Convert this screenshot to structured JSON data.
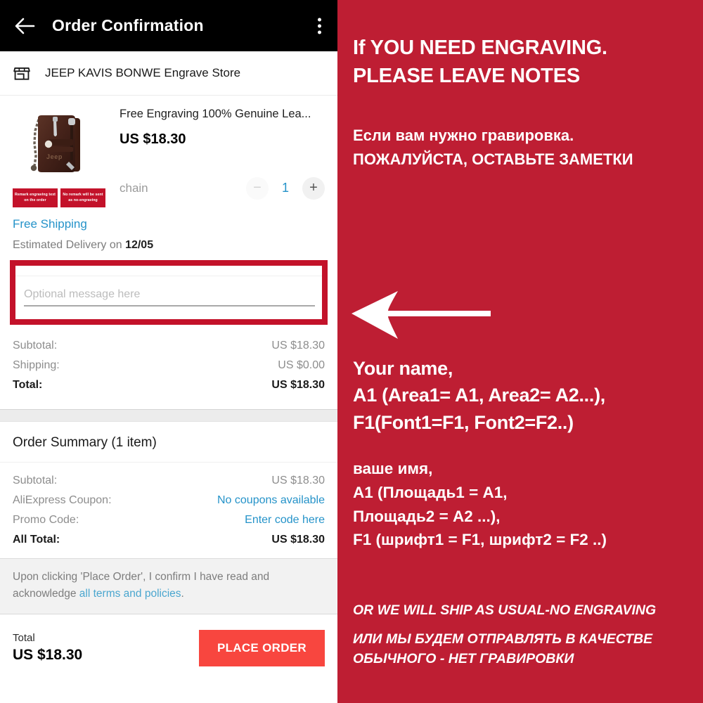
{
  "appbar": {
    "title": "Order Confirmation",
    "back_icon": "back-arrow-icon",
    "menu_icon": "overflow-menu-icon"
  },
  "store": {
    "icon": "storefront-icon",
    "name": "JEEP KAVIS BONWE Engrave Store"
  },
  "product": {
    "title": "Free Engraving 100% Genuine Lea...",
    "price": "US $18.30",
    "variant": "chain",
    "quantity": "1",
    "decrease_label": "−",
    "increase_label": "+",
    "image_badges": [
      "Remark engraving text on the order",
      "No remark will be sent as no-engraving"
    ],
    "image_brand": "Jeep"
  },
  "shipping": {
    "method": "Free Shipping",
    "eta_prefix": "Estimated Delivery on ",
    "eta_date": "12/05"
  },
  "message_box": {
    "placeholder": "Optional message here",
    "value": "",
    "highlight_color": "#c3122a"
  },
  "totals": [
    {
      "label": "Subtotal:",
      "value": "US $18.30",
      "strong": false
    },
    {
      "label": "Shipping:",
      "value": "US $0.00",
      "strong": false
    },
    {
      "label": "Total:",
      "value": "US $18.30",
      "strong": true
    }
  ],
  "order_summary": {
    "heading": "Order Summary (1 item)",
    "rows": [
      {
        "label": "Subtotal:",
        "value": "US $18.30",
        "link": false,
        "strong": false
      },
      {
        "label": "AliExpress Coupon:",
        "value": "No coupons available",
        "link": true,
        "strong": false
      },
      {
        "label": "Promo Code:",
        "value": "Enter code here",
        "link": true,
        "strong": false
      },
      {
        "label": "All Total:",
        "value": "US $18.30",
        "link": false,
        "strong": true
      }
    ]
  },
  "terms": {
    "text_before": "Upon clicking 'Place Order', I confirm I have read and acknowledge ",
    "link_text": "all terms and policies",
    "text_after": "."
  },
  "bottom_bar": {
    "total_label": "Total",
    "total_value": "US $18.30",
    "place_order_label": "PLACE ORDER",
    "place_order_color": "#f8463f"
  },
  "poster": {
    "background_color": "#be1e33",
    "heading_en": "If YOU NEED ENGRAVING. PLEASE LEAVE NOTES",
    "heading_ru": "Если вам нужно гравировка. ПОЖАЛУЙСТА, ОСТАВЬТЕ ЗАМЕТКИ",
    "arrow_icon": "left-arrow-icon",
    "example_en": "Your name,\nA1  (Area1= A1, Area2= A2...),\nF1(Font1=F1, Font2=F2..)",
    "example_ru": "ваше имя,\nA1 (Площадь1 = A1,\nПлощадь2 = A2 ...),\nF1 (шрифт1 = F1, шрифт2 = F2 ..)",
    "footer_en": "OR WE WILL SHIP AS USUAL-NO ENGRAVING",
    "footer_ru": "ИЛИ МЫ БУДЕМ ОТПРАВЛЯТЬ В КАЧЕСТВЕ ОБЫЧНОГО - НЕТ ГРАВИРОВКИ"
  }
}
